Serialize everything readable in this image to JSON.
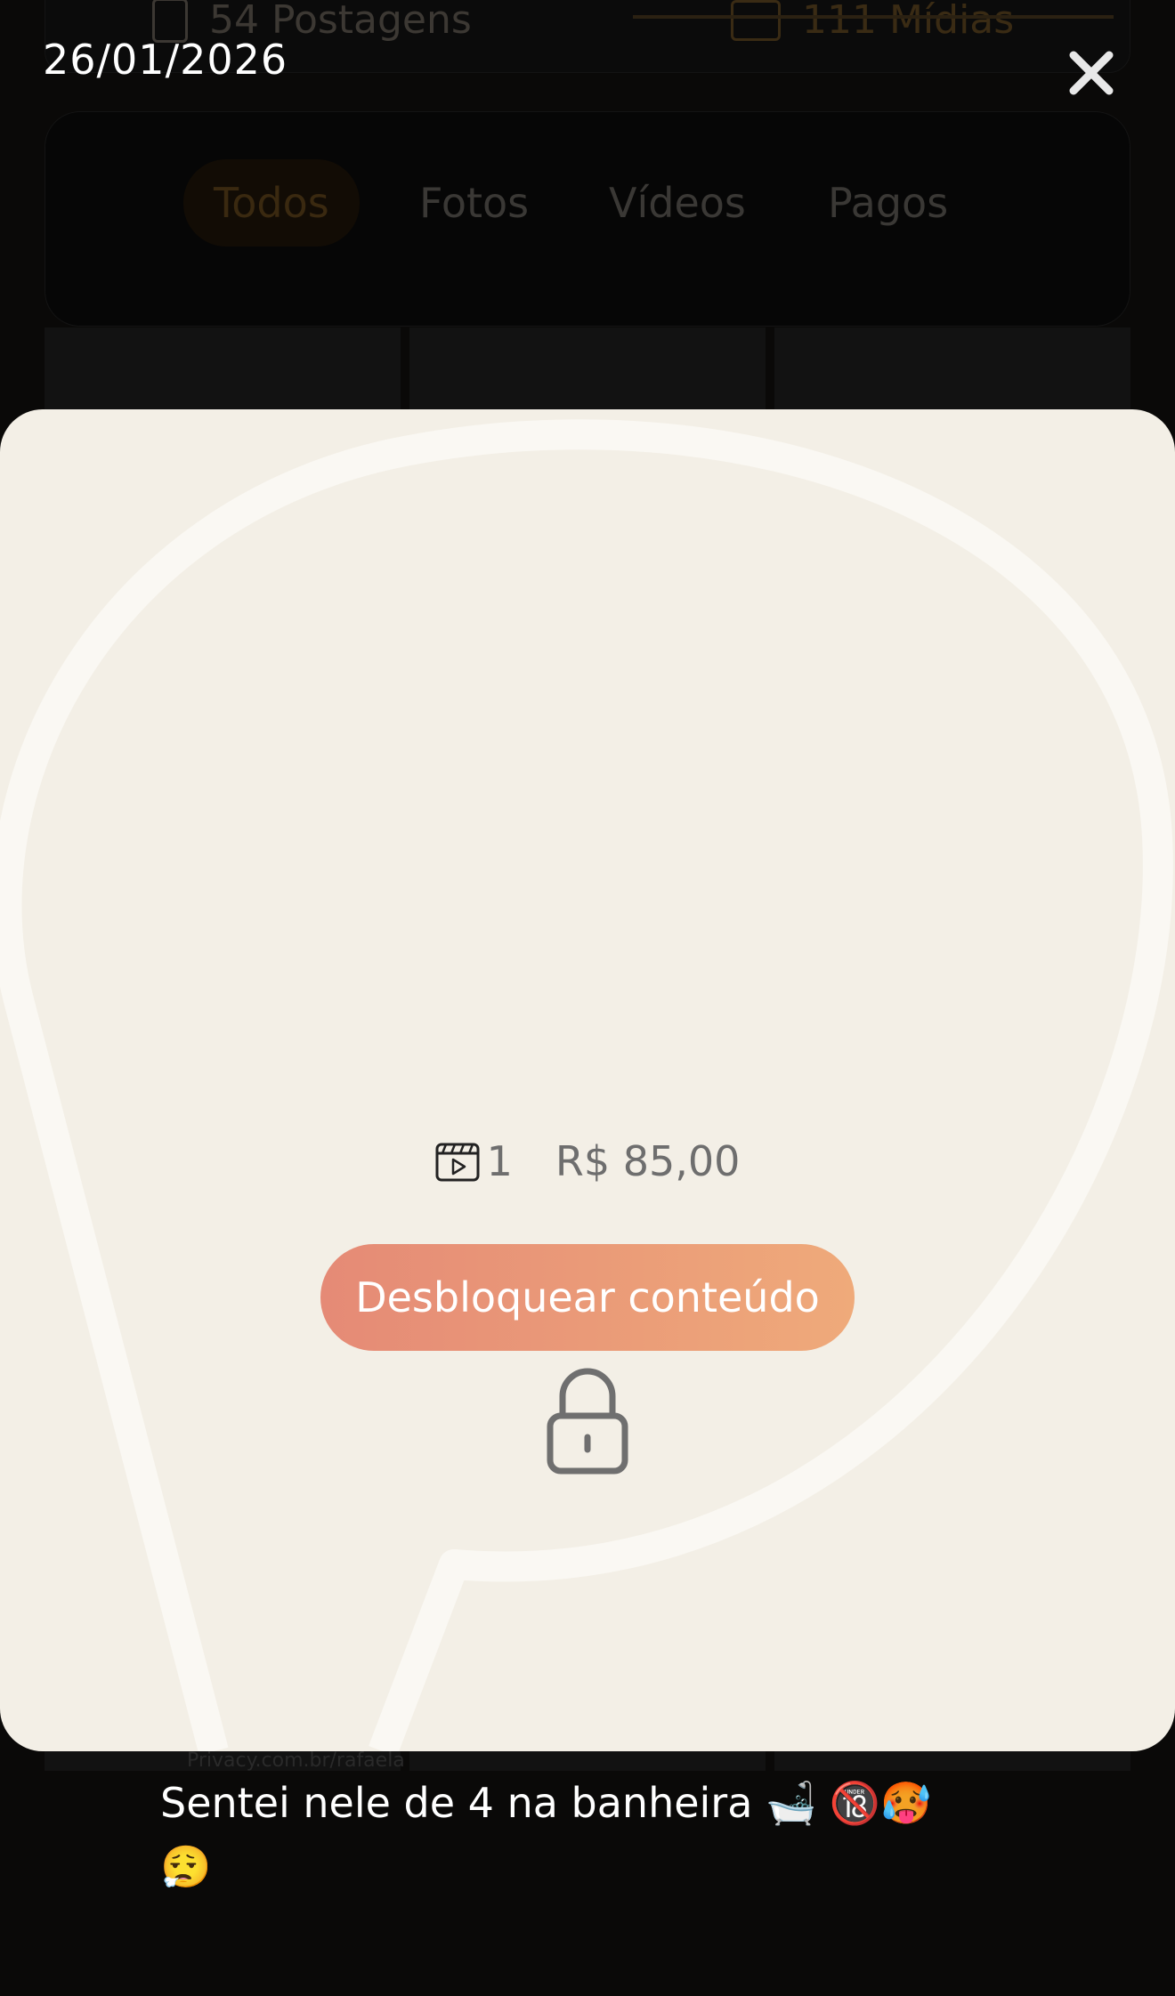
{
  "background": {
    "stats": {
      "posts_label": "54 Postagens",
      "media_label": "111 Mídias"
    },
    "filters": [
      "Todos",
      "Fotos",
      "Vídeos",
      "Pagos"
    ],
    "active_filter": "Todos",
    "watermark": "Privacy.com.br/rafaela"
  },
  "post": {
    "date": "26/01/2026",
    "close_icon": "close-icon",
    "media_count": "1",
    "media_icon": "video-clapper-icon",
    "price": "R$ 85,00",
    "unlock_label": "Desbloquear conteúdo",
    "caption": "Sentei nele de 4 na banheira 🛁 🔞🥵 😮‍💨"
  },
  "colors": {
    "accent_gradient_start": "#e58a76",
    "accent_gradient_end": "#efaa7a",
    "card_background": "#f3efe6",
    "overlay": "#000000"
  }
}
